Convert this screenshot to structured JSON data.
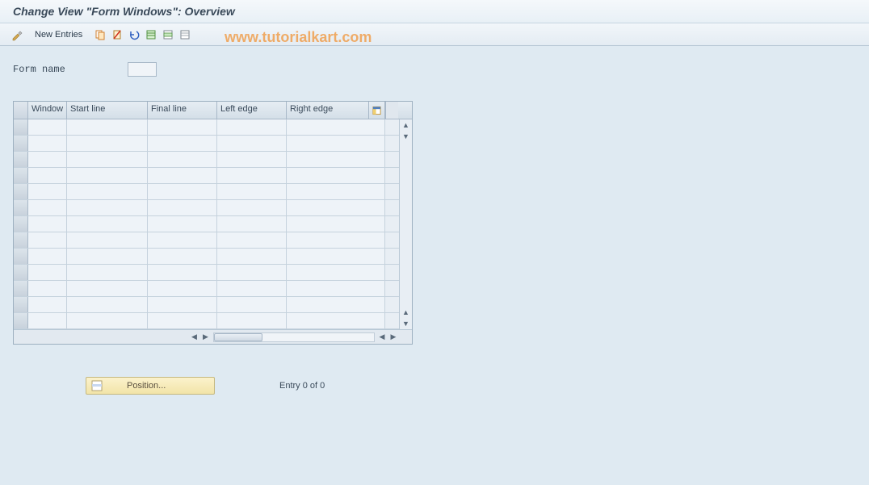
{
  "title": "Change View \"Form Windows\": Overview",
  "toolbar": {
    "new_entries_label": "New Entries",
    "icons": {
      "tool": "tool-icon",
      "copy": "copy-icon",
      "delete": "delete-icon",
      "undo": "undo-icon",
      "select_all": "select-all-icon",
      "select_block": "select-block-icon",
      "deselect": "deselect-icon"
    }
  },
  "watermark": "www.tutorialkart.com",
  "form": {
    "name_label": "Form name",
    "name_value": ""
  },
  "table": {
    "columns": {
      "window": "Window",
      "start_line": "Start line",
      "final_line": "Final line",
      "left_edge": "Left edge",
      "right_edge": "Right edge"
    },
    "rows": [
      {
        "window": "",
        "start_line": "",
        "final_line": "",
        "left_edge": "",
        "right_edge": ""
      },
      {
        "window": "",
        "start_line": "",
        "final_line": "",
        "left_edge": "",
        "right_edge": ""
      },
      {
        "window": "",
        "start_line": "",
        "final_line": "",
        "left_edge": "",
        "right_edge": ""
      },
      {
        "window": "",
        "start_line": "",
        "final_line": "",
        "left_edge": "",
        "right_edge": ""
      },
      {
        "window": "",
        "start_line": "",
        "final_line": "",
        "left_edge": "",
        "right_edge": ""
      },
      {
        "window": "",
        "start_line": "",
        "final_line": "",
        "left_edge": "",
        "right_edge": ""
      },
      {
        "window": "",
        "start_line": "",
        "final_line": "",
        "left_edge": "",
        "right_edge": ""
      },
      {
        "window": "",
        "start_line": "",
        "final_line": "",
        "left_edge": "",
        "right_edge": ""
      },
      {
        "window": "",
        "start_line": "",
        "final_line": "",
        "left_edge": "",
        "right_edge": ""
      },
      {
        "window": "",
        "start_line": "",
        "final_line": "",
        "left_edge": "",
        "right_edge": ""
      },
      {
        "window": "",
        "start_line": "",
        "final_line": "",
        "left_edge": "",
        "right_edge": ""
      },
      {
        "window": "",
        "start_line": "",
        "final_line": "",
        "left_edge": "",
        "right_edge": ""
      },
      {
        "window": "",
        "start_line": "",
        "final_line": "",
        "left_edge": "",
        "right_edge": ""
      }
    ]
  },
  "footer": {
    "position_label": "Position...",
    "entry_text": "Entry 0 of 0"
  }
}
